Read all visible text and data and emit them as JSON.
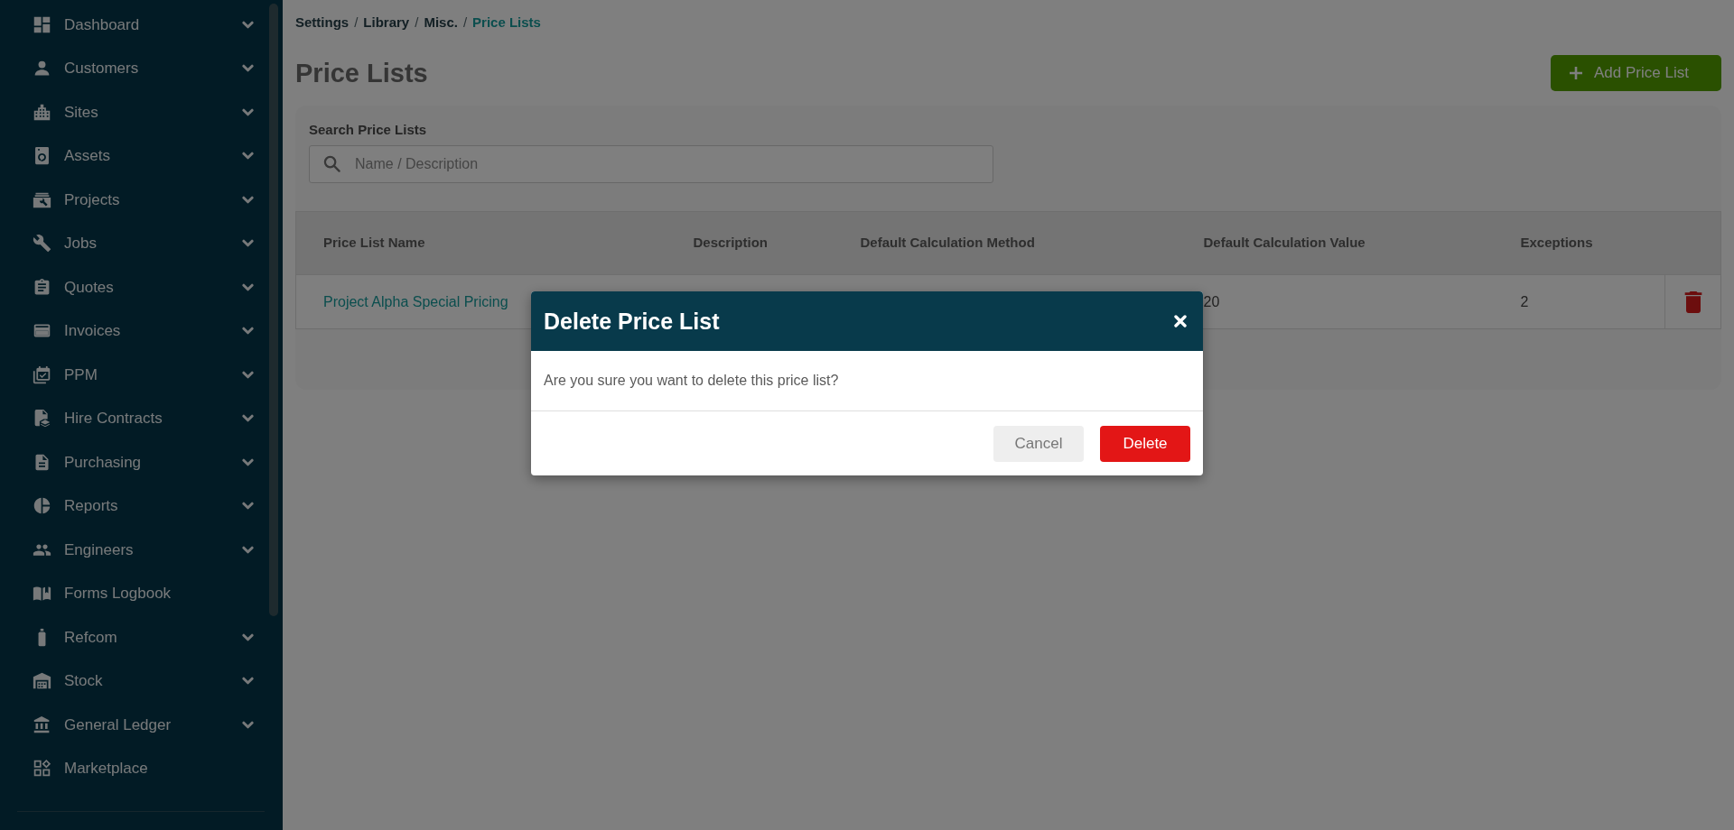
{
  "sidebar": {
    "items": [
      {
        "label": "Dashboard",
        "kind": "menu"
      },
      {
        "label": "Customers",
        "kind": "menu"
      },
      {
        "label": "Sites",
        "kind": "menu"
      },
      {
        "label": "Assets",
        "kind": "menu"
      },
      {
        "label": "Projects",
        "kind": "menu"
      },
      {
        "label": "Jobs",
        "kind": "menu"
      },
      {
        "label": "Quotes",
        "kind": "menu"
      },
      {
        "label": "Invoices",
        "kind": "menu"
      },
      {
        "label": "PPM",
        "kind": "menu"
      },
      {
        "label": "Hire Contracts",
        "kind": "menu"
      },
      {
        "label": "Purchasing",
        "kind": "menu"
      },
      {
        "label": "Reports",
        "kind": "menu"
      },
      {
        "label": "Engineers",
        "kind": "menu"
      },
      {
        "label": "Forms Logbook",
        "kind": "link"
      },
      {
        "label": "Refcom",
        "kind": "menu"
      },
      {
        "label": "Stock",
        "kind": "menu"
      },
      {
        "label": "General Ledger",
        "kind": "menu"
      },
      {
        "label": "Marketplace",
        "kind": "link"
      }
    ]
  },
  "breadcrumb": {
    "separator": "/",
    "items": [
      {
        "label": "Settings",
        "current": false
      },
      {
        "label": "Library",
        "current": false
      },
      {
        "label": "Misc.",
        "current": false
      },
      {
        "label": "Price Lists",
        "current": true
      }
    ]
  },
  "page": {
    "title": "Price Lists",
    "add_button": "Add Price List"
  },
  "search": {
    "label": "Search Price Lists",
    "placeholder": "Name / Description"
  },
  "table": {
    "columns": [
      "Price List Name",
      "Description",
      "Default Calculation Method",
      "Default Calculation Value",
      "Exceptions"
    ],
    "rows": [
      {
        "price_list_name": "Project Alpha Special Pricing",
        "default_calculation_value": "20",
        "exceptions": "2"
      }
    ]
  },
  "modal": {
    "title": "Delete Price List",
    "message": "Are you sure you want to delete this price list?",
    "buttons": [
      {
        "label": "Cancel",
        "kind": "secondary"
      },
      {
        "label": "Delete",
        "kind": "danger"
      }
    ]
  }
}
